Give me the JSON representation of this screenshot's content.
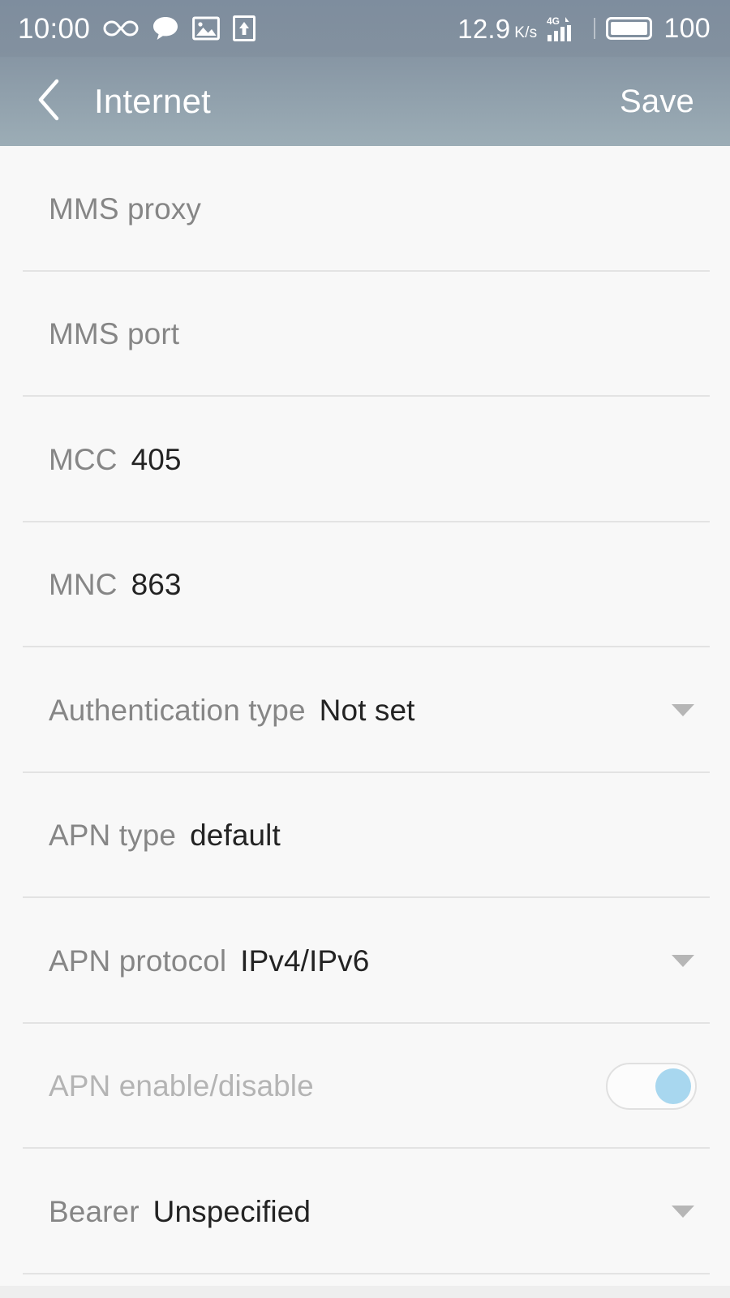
{
  "status_bar": {
    "clock": "10:00",
    "left_icons": [
      {
        "name": "infinity-icon",
        "glyph": "infinity"
      },
      {
        "name": "message-bubble-icon",
        "glyph": "bubble"
      },
      {
        "name": "image-icon",
        "glyph": "image"
      },
      {
        "name": "upload-icon",
        "glyph": "upload"
      }
    ],
    "network_speed": "12.9",
    "network_speed_unit": "K/s",
    "signal_icon": "4g-signal-icon",
    "signal_label": "4G",
    "battery_icon": "battery-full-icon",
    "battery_level": "100"
  },
  "app_bar": {
    "back_icon": "chevron-left-icon",
    "title": "Internet",
    "save_label": "Save"
  },
  "colors": {
    "status_bar_top": "#7e8d9e",
    "app_bar_bottom": "#9cadb6",
    "label": "#868686",
    "label_muted": "#b4b4b4",
    "value": "#232323",
    "divider": "#e3e3e3",
    "background": "#f8f8f8",
    "toggle_knob": "#a8d7ef",
    "caret": "#b6b6b6"
  },
  "settings": {
    "rows": [
      {
        "label": "MMS proxy",
        "value": "",
        "control": "none",
        "muted": false
      },
      {
        "label": "MMS port",
        "value": "",
        "control": "none",
        "muted": false
      },
      {
        "label": "MCC",
        "value": "405",
        "control": "none",
        "muted": false
      },
      {
        "label": "MNC",
        "value": "863",
        "control": "none",
        "muted": false
      },
      {
        "label": "Authentication type",
        "value": "Not set",
        "control": "caret",
        "muted": false
      },
      {
        "label": "APN type",
        "value": "default",
        "control": "none",
        "muted": false
      },
      {
        "label": "APN protocol",
        "value": "IPv4/IPv6",
        "control": "caret",
        "muted": false
      },
      {
        "label": "APN enable/disable",
        "value": "",
        "control": "toggle",
        "muted": true,
        "toggle_on": true
      },
      {
        "label": "Bearer",
        "value": "Unspecified",
        "control": "caret",
        "muted": false
      }
    ]
  }
}
